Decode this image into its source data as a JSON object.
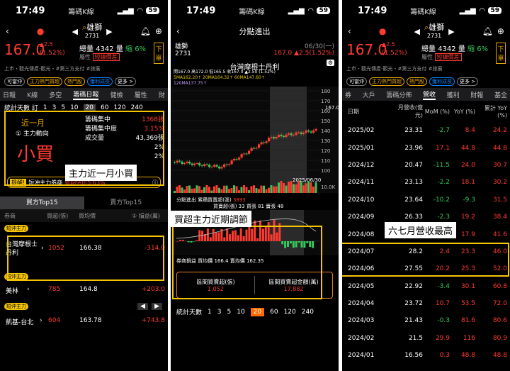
{
  "status": {
    "time": "17:49",
    "app": "籌碼K線",
    "battery": "59"
  },
  "stock": {
    "name": "雄獅",
    "code": "2731",
    "price": "167.0",
    "change": "▲2.5",
    "pct": "(1.52%)",
    "volume_label": "總量",
    "volume": "4342",
    "vol_ratio_label": "量",
    "vol_ratio": "縮 6%",
    "attr": "屬性",
    "badge": "短線價差",
    "sell_btn": "下單",
    "tags": "上市・觀光傳產-觀光・#第三方支付 #旅展"
  },
  "p1": {
    "chips": [
      "可當沖",
      "主力熱門買超",
      "熱門股",
      "獲利成長",
      "更多 >"
    ],
    "tabs": [
      "日報",
      "K線",
      "多空",
      "籌碼日報",
      "健檢",
      "屬性",
      "財"
    ],
    "days_label": "統計天數 訂",
    "days": [
      "1",
      "3",
      "5",
      "10",
      "20",
      "60",
      "120",
      "240"
    ],
    "period": "近一月",
    "force_label": "① 主力動向",
    "force": "小買",
    "metrics": [
      {
        "k": "籌碼集中",
        "v": "1368張"
      },
      {
        "k": "籌碼集中度",
        "v": "3.15%"
      },
      {
        "k": "成交量",
        "v": "43,369張"
      },
      {
        "k": "",
        "v": "2%"
      },
      {
        "k": "",
        "v": "2%"
      }
    ],
    "hint_tag": "提醒!",
    "hint": "短沖主力券商",
    "hint_red": "買超佔比5.63%",
    "top_tabs": [
      "買方Top15",
      "賣方Top15"
    ],
    "cols": [
      "券商",
      "買超(張)",
      "買均價",
      "① 損益(萬)"
    ],
    "rows": [
      {
        "tag": "短沖主力",
        "name": "台灣摩根士丹利",
        "buy": "1052",
        "avg": "166.38",
        "pl": "-314.0"
      },
      {
        "tag": "短沖主力",
        "name": "美林",
        "buy": "785",
        "avg": "164.8",
        "pl": "+203.0"
      },
      {
        "tag": "短沖主力",
        "name": "凱基-台北",
        "buy": "604",
        "avg": "163.78",
        "pl": "+743.8"
      }
    ],
    "callout": "主力近一月小買"
  },
  "p2": {
    "title": "分點進出",
    "date": "06/30(一)",
    "broker": "台灣摩根士丹利",
    "ohlc": "開167.0 高172.0 低165.5 收167.0 ▲2.50 (1.52%)",
    "ma": "5MA162.20↑  20MA164.32↑  60MA147.60↑",
    "ma2": "120MA137.75↑",
    "price_ticks": [
      "180",
      "170",
      "160",
      "150",
      "140",
      "130",
      "120",
      "110",
      "100"
    ],
    "price_tag": "167.0",
    "date_tag": "2025/06/30",
    "vol_tick": "10.0K",
    "sub_title": "分點進出",
    "sub_acc": "累積買賣超(張)",
    "sub_acc_val": "3893",
    "sub_line": "買賣超(張) 33 買張 81 賣張 48",
    "pl_label": "券商損益",
    "pl_line": "買均價 166.4 賣均價 162.35",
    "callout": "買超主力近期調節",
    "sum_labels": [
      "區間買賣超(張)",
      "區間買賣超金額(萬)"
    ],
    "sum_vals": [
      "1,052",
      "17,882"
    ],
    "days_label": "統計天數",
    "days": [
      "1",
      "3",
      "5",
      "10",
      "20",
      "60",
      "120",
      "240"
    ]
  },
  "p3": {
    "tabs": [
      "券",
      "大戶",
      "籌碼分佈",
      "營收",
      "獲利",
      "財報",
      "基全"
    ],
    "cols": [
      "日期",
      "月營收(億元)",
      "MoM (%)",
      "YoY (%)",
      "累計 YoY (%)"
    ],
    "rows": [
      [
        "2025/02",
        "23.31",
        "-2.7",
        "8.4",
        "24.2"
      ],
      [
        "2025/01",
        "23.96",
        "17.1",
        "44.8",
        "44.8"
      ],
      [
        "2024/12",
        "20.47",
        "-11.5",
        "24.0",
        "30.7"
      ],
      [
        "2024/11",
        "23.13",
        "-2.2",
        "18.1",
        "30.2"
      ],
      [
        "2024/10",
        "23.64",
        "-10.2",
        "-9.3",
        "31.5"
      ],
      [
        "2024/09",
        "26.33",
        "-2.3",
        "19.2",
        "38.4"
      ],
      [
        "2024/08",
        "26.96",
        "-2.2",
        "17.9",
        "41.6"
      ],
      [
        "2024/07",
        "28.2",
        "2.4",
        "23.3",
        "46.0"
      ],
      [
        "2024/06",
        "27.55",
        "20.2",
        "25.3",
        "52.0"
      ],
      [
        "2024/05",
        "22.92",
        "-3.4",
        "30.1",
        "60.8"
      ],
      [
        "2024/04",
        "23.72",
        "10.7",
        "53.5",
        "72.0"
      ],
      [
        "2024/03",
        "21.43",
        "-0.3",
        "81.6",
        "80.6"
      ],
      [
        "2024/02",
        "21.5",
        "29.9",
        "116",
        "80.9"
      ],
      [
        "2024/01",
        "16.56",
        "0.3",
        "48.8",
        "48.8"
      ]
    ],
    "callout": "六七月營收最高"
  }
}
